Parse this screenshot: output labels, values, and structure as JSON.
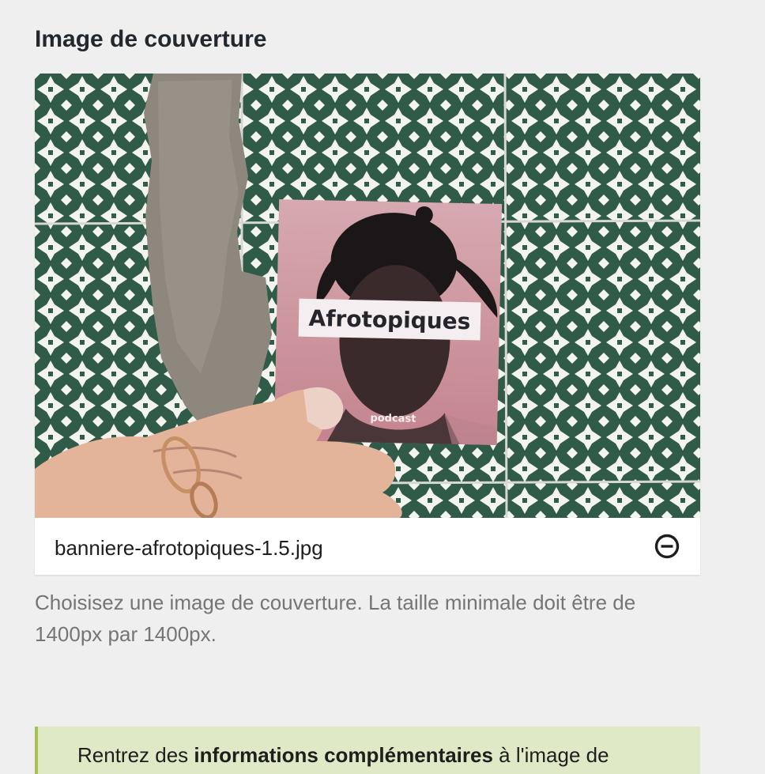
{
  "section": {
    "title": "Image de couverture"
  },
  "cover": {
    "card_title": "Afrotopiques",
    "card_subtitle": "podcast",
    "file_name": "banniere-afrotopiques-1.5.jpg",
    "remove_icon": "minus-circle-icon"
  },
  "help": {
    "text": "Choisisez une image de couverture. La taille minimale doit être de 1400px par 1400px."
  },
  "notice": {
    "prefix": "Rentrez des ",
    "emphasis": "informations complémentaires",
    "suffix": " à l'image de"
  },
  "colors": {
    "background": "#efefef",
    "tile_green": "#2f5b48",
    "notice_bg": "#dfe9c6",
    "notice_border": "#a5c155"
  }
}
